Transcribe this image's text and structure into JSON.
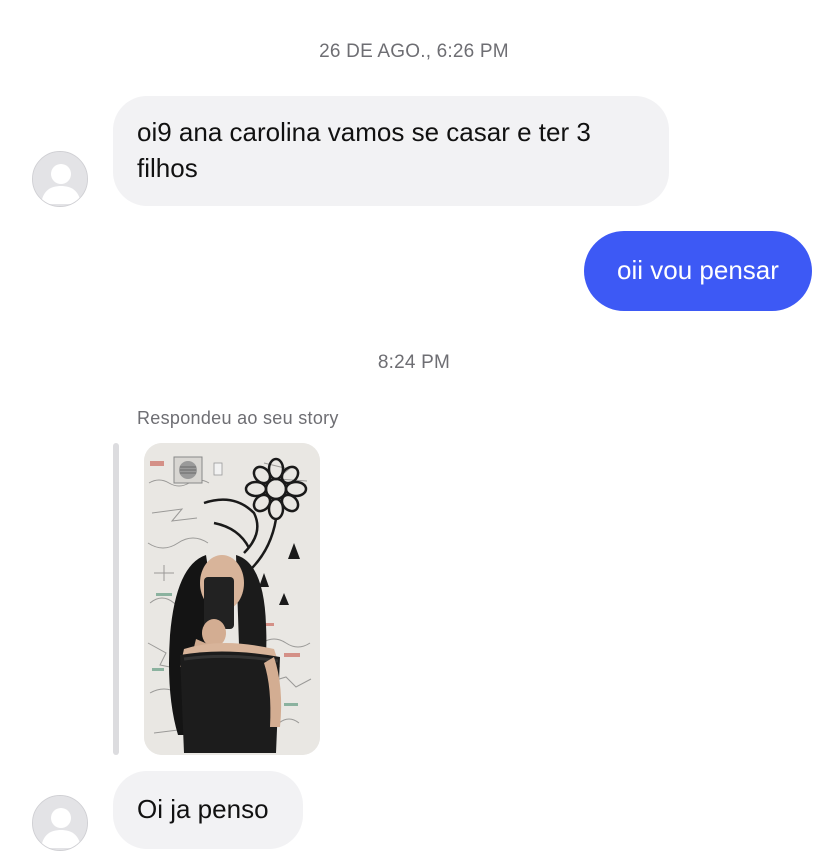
{
  "conversation": {
    "timestamps": {
      "first": "26 DE AGO., 6:26 PM",
      "second": "8:24 PM"
    },
    "messages": [
      {
        "direction": "incoming",
        "text": "oi9 ana carolina vamos se casar e ter 3 filhos"
      },
      {
        "direction": "outgoing",
        "text": "oii vou pensar"
      },
      {
        "direction": "incoming",
        "text": "Oi ja penso"
      }
    ],
    "story_reply": {
      "label": "Respondeu ao seu story",
      "thumbnail_icon": "story-image"
    }
  },
  "colors": {
    "outgoing_bubble": "#3d59f5",
    "incoming_bubble": "#f2f2f4",
    "timestamp_text": "#6e6e73",
    "reply_bar": "#dcdcdf"
  },
  "icons": {
    "avatar": "default-avatar-icon"
  }
}
